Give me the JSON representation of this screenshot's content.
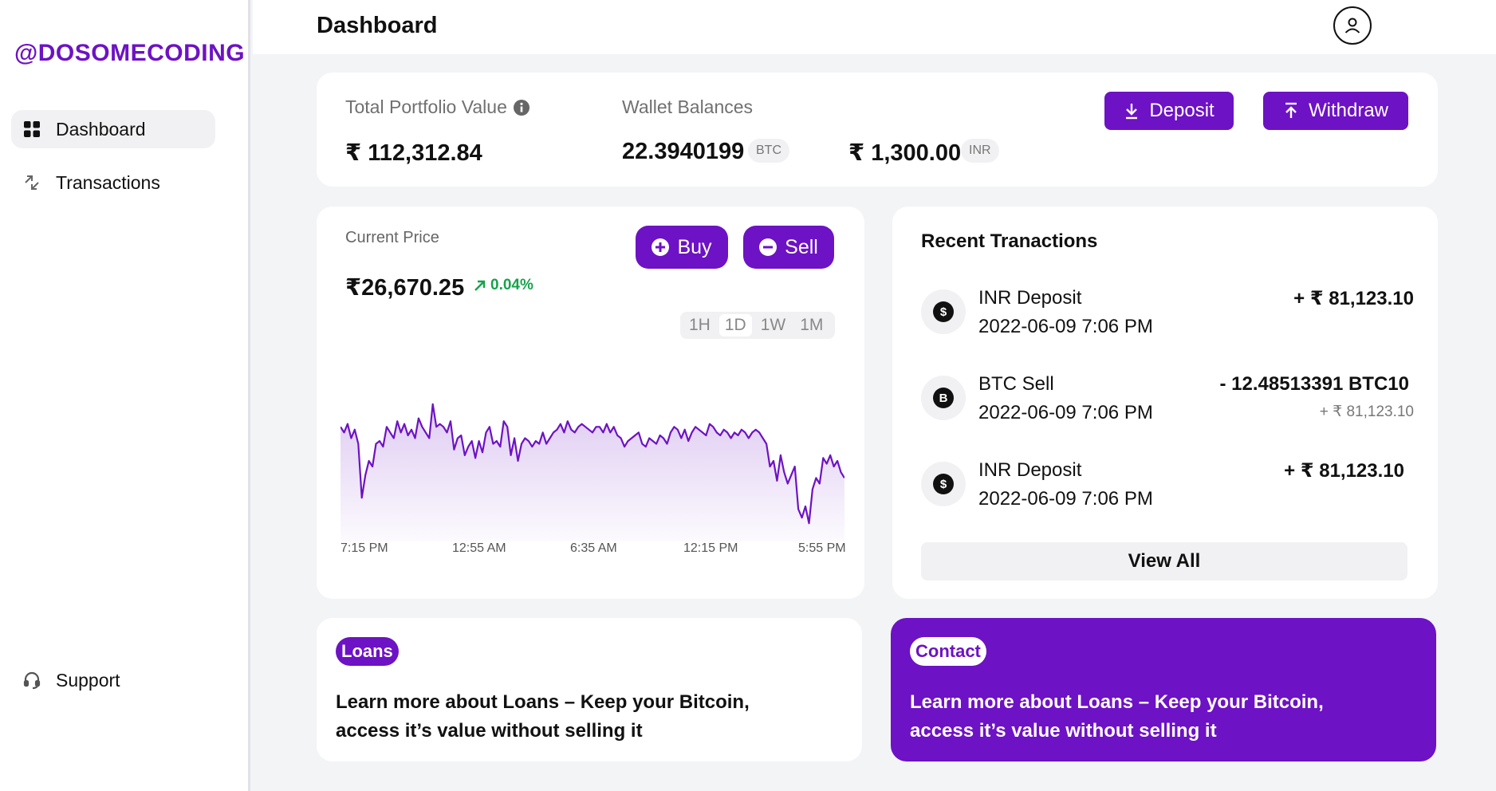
{
  "sidebar": {
    "logo": "@DOSOMECODING",
    "items": [
      {
        "label": "Dashboard",
        "icon": "grid-icon",
        "active": true
      },
      {
        "label": "Transactions",
        "icon": "arrows-diagonal-icon",
        "active": false
      }
    ],
    "support": {
      "label": "Support",
      "icon": "headset-icon"
    }
  },
  "header": {
    "title": "Dashboard",
    "avatar_icon": "user-icon"
  },
  "portfolio": {
    "total_label": "Total Portfolio Value",
    "total_value": "₹ 112,312.84",
    "wallet_label": "Wallet Balances",
    "btc_value": "22.3940199",
    "btc_unit": "BTC",
    "inr_value": "₹ 1,300.00",
    "inr_unit": "INR",
    "deposit_label": "Deposit",
    "withdraw_label": "Withdraw"
  },
  "price": {
    "label": "Current Price",
    "value": "₹26,670.25",
    "change": "0.04%",
    "buy_label": "Buy",
    "sell_label": "Sell",
    "ranges": [
      "1H",
      "1D",
      "1W",
      "1M"
    ],
    "selected_range": "1D"
  },
  "chart_data": {
    "type": "area",
    "x_ticks": [
      "7:15 PM",
      "12:55 AM",
      "6:35 AM",
      "12:15 PM",
      "5:55 PM"
    ],
    "values": [
      72,
      70,
      73,
      68,
      71,
      66,
      47,
      55,
      60,
      58,
      66,
      67,
      65,
      72,
      70,
      68,
      74,
      70,
      73,
      69,
      71,
      68,
      75,
      72,
      70,
      68,
      80,
      72,
      73,
      72,
      70,
      74,
      64,
      68,
      69,
      62,
      65,
      67,
      61,
      67,
      63,
      70,
      72,
      66,
      67,
      65,
      74,
      72,
      62,
      68,
      60,
      66,
      68,
      67,
      65,
      67,
      66,
      70,
      66,
      68,
      70,
      71,
      73,
      70,
      74,
      71,
      70,
      72,
      73,
      72,
      71,
      70,
      72,
      72,
      70,
      73,
      70,
      72,
      69,
      68,
      65,
      67,
      68,
      69,
      70,
      66,
      65,
      68,
      67,
      66,
      69,
      68,
      66,
      70,
      72,
      71,
      68,
      71,
      67,
      70,
      72,
      71,
      70,
      69,
      73,
      72,
      70,
      69,
      71,
      70,
      68,
      70,
      69,
      71,
      70,
      68,
      70,
      71,
      70,
      68,
      66,
      58,
      60,
      53,
      62,
      56,
      52,
      55,
      58,
      43,
      40,
      44,
      38,
      50,
      54,
      52,
      61,
      59,
      62,
      58,
      60,
      56,
      54
    ],
    "title": "",
    "xlabel": "",
    "ylabel": "",
    "grid": false,
    "color": "#6d12c4"
  },
  "recent": {
    "title": "Recent Tranactions",
    "transactions": [
      {
        "icon": "dollar-coin-icon",
        "glyph": "$",
        "title": "INR Deposit",
        "date": "2022-06-09 7:06 PM",
        "amount": "+ ₹ 81,123.10",
        "sub": ""
      },
      {
        "icon": "bitcoin-coin-icon",
        "glyph": "B",
        "title": "BTC Sell",
        "date": "2022-06-09 7:06 PM",
        "amount": "- 12.48513391 BTC10",
        "sub": "+ ₹ 81,123.10"
      },
      {
        "icon": "dollar-coin-icon",
        "glyph": "$",
        "title": "INR Deposit",
        "date": "2022-06-09 7:06 PM",
        "amount": "+ ₹ 81,123.10",
        "sub": ""
      }
    ],
    "view_all": "View All"
  },
  "promos": [
    {
      "tag": "Loans",
      "text": "Learn more about Loans – Keep your Bitcoin, access it’s value without selling it"
    },
    {
      "tag": "Contact",
      "text": "Learn more about Loans – Keep your Bitcoin, access it’s value without selling it"
    }
  ],
  "colors": {
    "accent": "#6d12c4",
    "positive": "#16a34a",
    "background": "#f3f4f6"
  }
}
